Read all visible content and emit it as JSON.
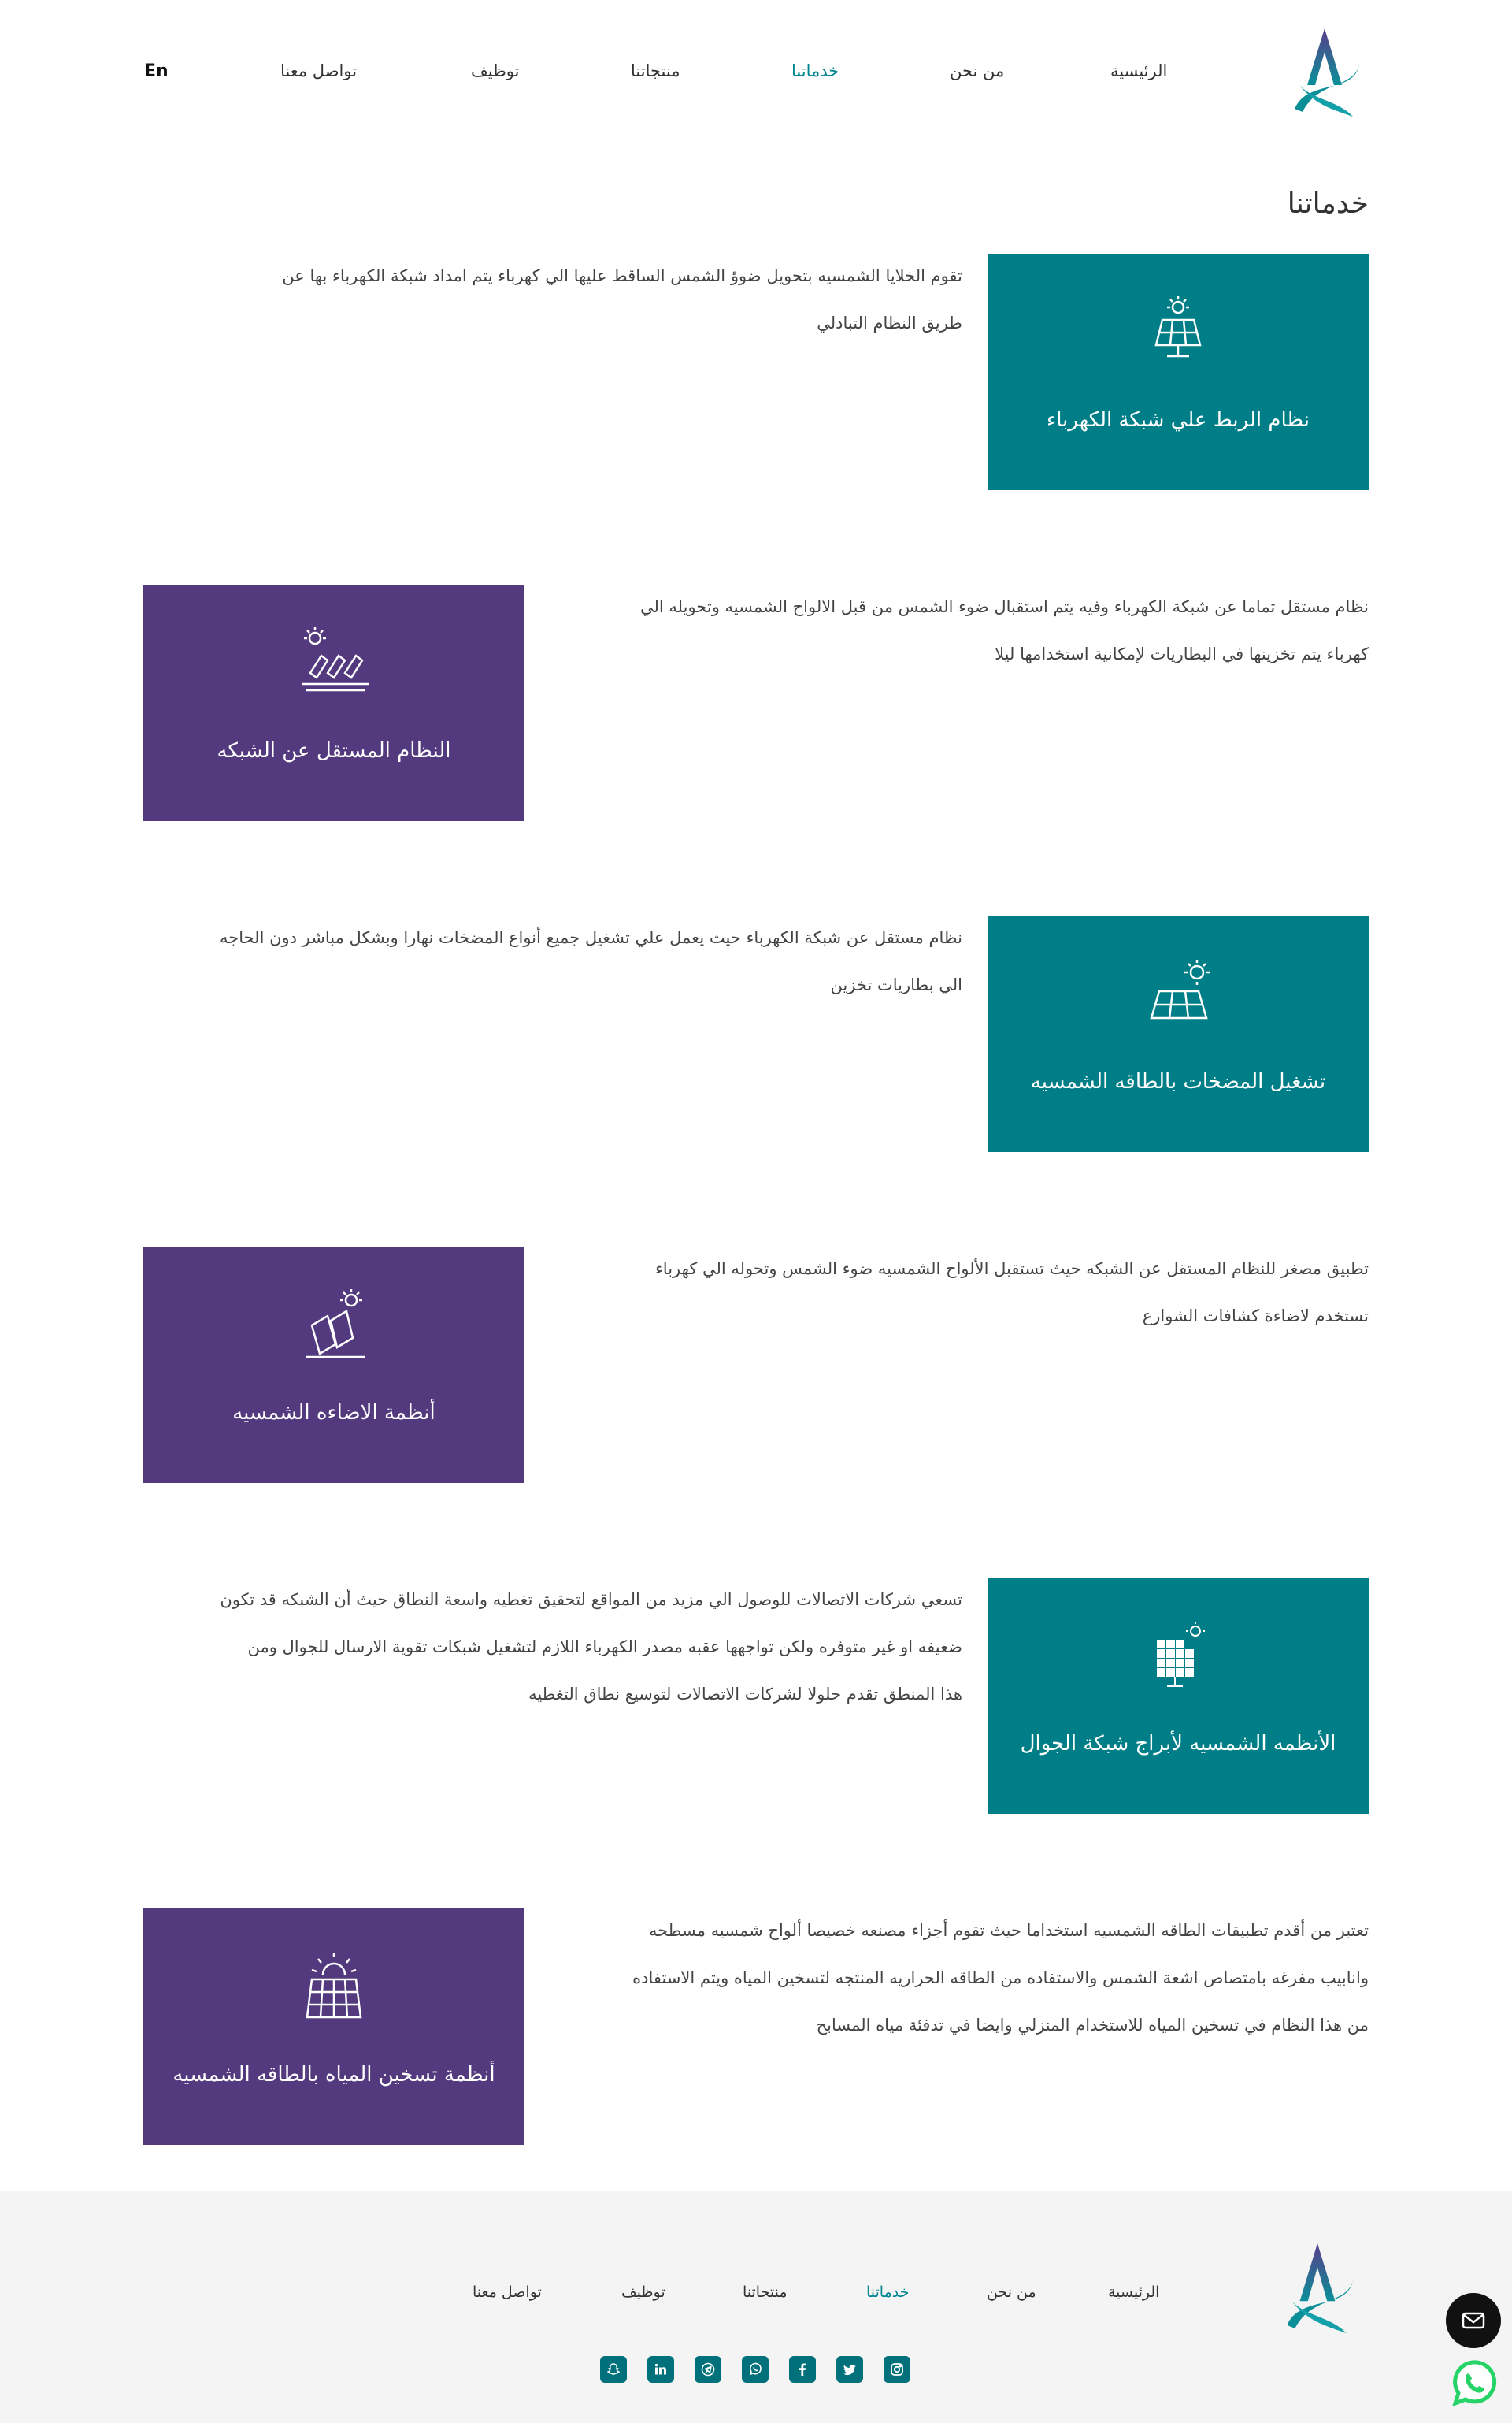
{
  "header": {
    "lang_label": "En",
    "nav": {
      "home": "الرئيسية",
      "about": "من نحن",
      "services": "خدماتنا",
      "products": "منتجاتنا",
      "jobs": "توظيف",
      "contact": "تواصل معنا"
    }
  },
  "page_title": "خدماتنا",
  "services": [
    {
      "title": "نظام الربط علي شبكة الكهرباء",
      "icon": "solar-panel-grid-icon",
      "desc_1": "تقوم الخلايا الشمسيه بتحويل ضوؤ الشمس الساقط عليها الي كهرباء يتم امداد شبكة الكهرباء بها عن",
      "desc_2": "طريق النظام التبادلي"
    },
    {
      "title": "النظام المستقل عن الشبكه",
      "icon": "solar-panels-row-icon",
      "desc_1": "نظام مستقل تماما عن شبكة الكهرباء وفيه يتم استقبال ضوء الشمس من قبل الالواح الشمسيه وتحويله الي",
      "desc_2": "كهرباء يتم تخزينها في البطاريات لإمكانية استخدامها ليلا"
    },
    {
      "title": "تشغيل المضخات بالطاقه الشمسيه",
      "icon": "solar-panel-sun-icon",
      "desc_1": "نظام مستقل عن شبكة الكهرباء حيث يعمل علي تشغيل جميع أنواع المضخات نهارا وبشكل مباشر دون الحاجه",
      "desc_2": "الي بطاريات تخزين"
    },
    {
      "title": "أنظمة الاضاءه الشمسيه",
      "icon": "solar-lighting-icon",
      "desc_1": "تطبيق مصغر للنظام المستقل عن الشبكه حيث تستقبل الألواح الشمسيه ضوء الشمس وتحوله الي كهرباء",
      "desc_2": "تستخدم لاضاءة كشافات الشوارع"
    },
    {
      "title": "الأنظمه الشمسيه لأبراج شبكة الجوال",
      "icon": "solar-tower-icon",
      "desc_1": "تسعي شركات الاتصالات للوصول الي مزيد من المواقع لتحقيق تغطيه واسعة النطاق حيث أن الشبكه قد تكون",
      "desc_2": "ضعيفه او غير متوفره ولكن تواجهها عقبه مصدر الكهرباء اللازم لتشغيل شبكات تقوية الارسال للجوال ومن",
      "desc_3": "هذا المنطق تقدم حلولا لشركات الاتصالات لتوسيع نطاق التغطيه"
    },
    {
      "title": "أنظمة تسخين المياه بالطاقه الشمسيه",
      "icon": "solar-water-heater-icon",
      "desc_1": "تعتبر من أقدم تطبيقات الطاقه الشمسيه استخداما حيث تقوم أجزاء مصنعه خصيصا ألواح شمسيه مسطحه",
      "desc_2": "وانابيب مفرغه بامتصاص اشعة الشمس والاستفاده من الطاقه الحراريه المنتجه لتسخين المياه ويتم الاستفاده",
      "desc_3": "من هذا النظام في تسخين المياه للاستخدام المنزلي وايضا في تدفئة مياه المسابح"
    }
  ],
  "footer": {
    "nav": {
      "home": "الرئيسية",
      "about": "من نحن",
      "services": "خدماتنا",
      "products": "منتجاتنا",
      "jobs": "توظيف",
      "contact": "تواصل معنا"
    },
    "social": [
      "instagram-icon",
      "twitter-icon",
      "facebook-icon",
      "whatsapp-icon",
      "telegram-icon",
      "linkedin-icon",
      "snapchat-icon"
    ]
  },
  "colors": {
    "teal": "#007e87",
    "purple": "#533a7e",
    "accent": "#008591"
  }
}
